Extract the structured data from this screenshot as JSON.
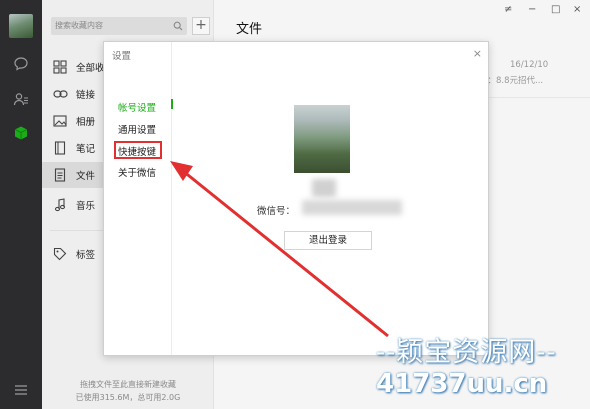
{
  "favorites": {
    "search_placeholder": "搜索收藏内容",
    "add_label": "+",
    "items": [
      {
        "label": "全部收"
      },
      {
        "label": "链接"
      },
      {
        "label": "相册"
      },
      {
        "label": "笔记"
      },
      {
        "label": "文件"
      },
      {
        "label": "音乐"
      }
    ],
    "tags_label": "标签",
    "footer_hint": "拖拽文件至此直接新建收藏",
    "footer_usage": "已使用315.6M，总可用2.0G"
  },
  "main": {
    "title": "文件",
    "window_controls": [
      "≠",
      "−",
      "□",
      "×"
    ],
    "file_date": "16/12/10",
    "file_meta": "自：8.8元招代..."
  },
  "dialog": {
    "title": "设置",
    "close": "×",
    "tabs": [
      {
        "label": "帐号设置"
      },
      {
        "label": "通用设置"
      },
      {
        "label": "快捷按键"
      },
      {
        "label": "关于微信"
      }
    ],
    "wechat_id_label": "微信号：",
    "logout_label": "退出登录"
  },
  "watermark": {
    "line1": "--颖宝资源网--",
    "line2": "41737uu.cn"
  },
  "colors": {
    "accent_green": "#1aad19",
    "highlight_red": "#e23030",
    "rail_bg": "#2c2c2f"
  }
}
